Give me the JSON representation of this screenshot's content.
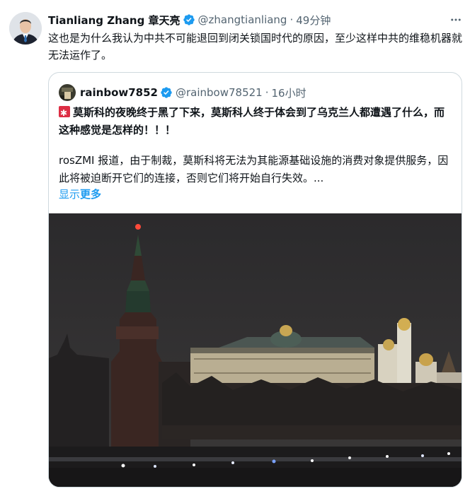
{
  "tweet": {
    "author_name": "Tianliang Zhang 章天亮",
    "handle": "@zhangtianliang",
    "separator": "·",
    "time": "49分钟",
    "text": "这也是为什么我认为中共不可能退回到闭关锁国时代的原因，至少这样中共的维稳机器就无法运作了。"
  },
  "quoted": {
    "author_name": "rainbow7852",
    "handle": "@rainbow78521",
    "separator": "·",
    "time": "16小时",
    "title": "莫斯科的夜晚终于黑了下来，莫斯科人终于体会到了乌克兰人都遭遇了什么，而这种感觉是怎样的！！！",
    "body": "rosZMI 报道，由于制裁，莫斯科将无法为其能源基础设施的消费对象提供服务，因此将被迫断开它们的连接，否则它们将开始自行失效。...",
    "show_more_1": "显示",
    "show_more_2": "更多"
  },
  "colors": {
    "verified": "#1d9bf0",
    "link": "#1d9bf0",
    "muted": "#536471",
    "border": "#cfd9de"
  },
  "icons": [
    "verified-badge-icon",
    "more-options-icon",
    "red-square-emoji-icon"
  ]
}
